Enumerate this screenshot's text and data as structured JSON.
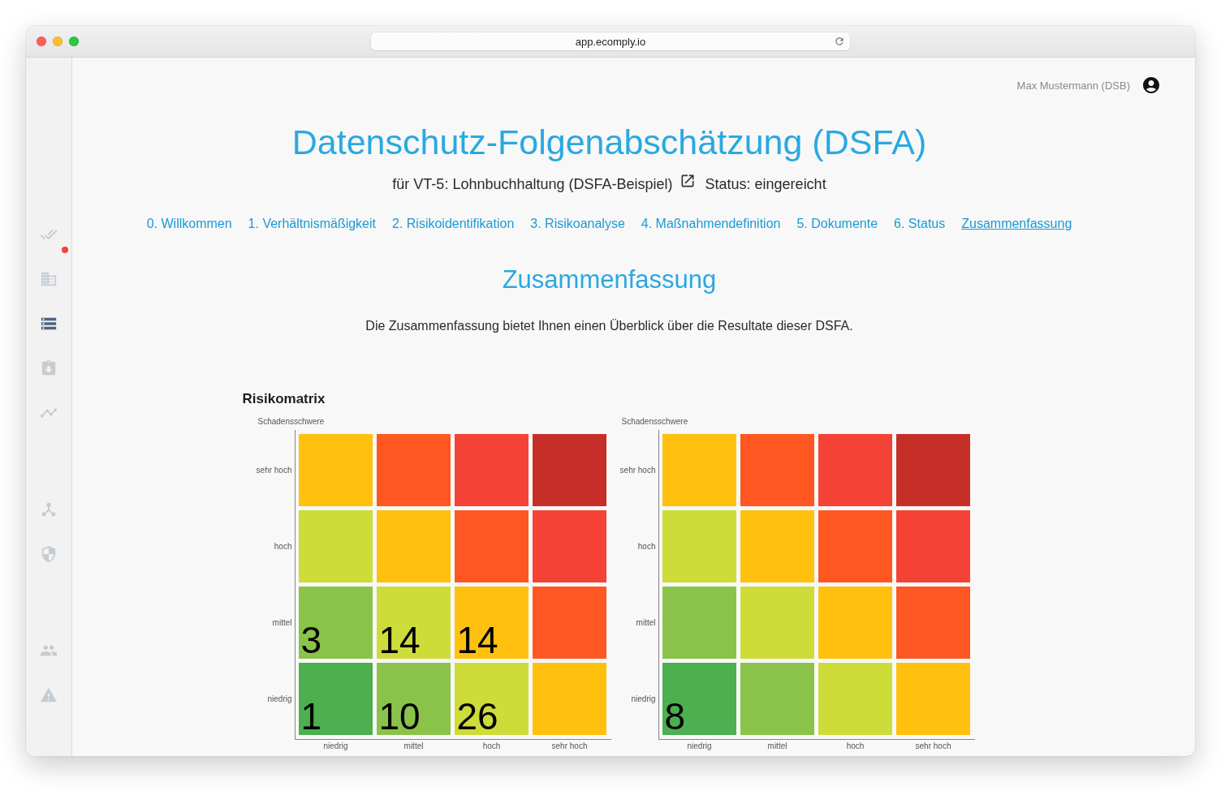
{
  "window": {
    "url": "app.ecomply.io"
  },
  "sidebar": {
    "groups": [
      {
        "items": [
          {
            "selected": false,
            "notification": true
          },
          {
            "selected": false,
            "notification": false
          },
          {
            "selected": true,
            "notification": false
          },
          {
            "selected": false,
            "notification": false
          },
          {
            "selected": false,
            "notification": false
          }
        ]
      },
      {
        "items": [
          {
            "selected": false,
            "notification": false
          },
          {
            "selected": false,
            "notification": false
          }
        ]
      },
      {
        "items": [
          {
            "selected": false,
            "notification": false
          },
          {
            "selected": false,
            "notification": false
          }
        ]
      }
    ]
  },
  "header": {
    "user": "Max Mustermann (DSB)"
  },
  "page": {
    "title": "Datenschutz-Folgenabschätzung (DSFA)",
    "subtitle": "für VT-5: Lohnbuchhaltung (DSFA-Beispiel)",
    "status": "Status: eingereicht"
  },
  "steps": [
    {
      "label": "0. Willkommen",
      "selected": false
    },
    {
      "label": "1. Verhältnismäßigkeit",
      "selected": false
    },
    {
      "label": "2. Risikoidentifikation",
      "selected": false
    },
    {
      "label": "3. Risikoanalyse",
      "selected": false
    },
    {
      "label": "4. Maßnahmendefinition",
      "selected": false
    },
    {
      "label": "5. Dokumente",
      "selected": false
    },
    {
      "label": "6. Status",
      "selected": false
    },
    {
      "label": "Zusammenfassung",
      "selected": true
    }
  ],
  "section": {
    "title": "Zusammenfassung",
    "intro": "Die Zusammenfassung bietet Ihnen einen Überblick über die Resultate dieser DSFA."
  },
  "risk_matrix": {
    "title": "Risikomatrix",
    "matrices": [
      {
        "ylabel": "Schadensschwere",
        "row_labels": [
          "sehr hoch",
          "hoch",
          "mittel",
          "niedrig"
        ],
        "column_labels": [
          "niedrig",
          "mittel",
          "hoch",
          "sehr hoch"
        ],
        "rows": [
          [
            {
              "color": "#ffc10e"
            },
            {
              "color": "#ff5722"
            },
            {
              "color": "#f44336"
            },
            {
              "color": "#c62f28"
            }
          ],
          [
            {
              "color": "#cddc39"
            },
            {
              "color": "#ffc10e"
            },
            {
              "color": "#ff5722"
            },
            {
              "color": "#f44336"
            }
          ],
          [
            {
              "color": "#8bc34a",
              "count": "3"
            },
            {
              "color": "#cddc39",
              "count": "14"
            },
            {
              "color": "#ffc10e",
              "count": "14"
            },
            {
              "color": "#ff5722"
            }
          ],
          [
            {
              "color": "#4caf50",
              "count": "1"
            },
            {
              "color": "#8bc34a",
              "count": "10"
            },
            {
              "color": "#cddc39",
              "count": "26"
            },
            {
              "color": "#ffc10e"
            }
          ]
        ]
      },
      {
        "ylabel": "Schadensschwere",
        "row_labels": [
          "sehr hoch",
          "hoch",
          "mittel",
          "niedrig"
        ],
        "column_labels": [
          "niedrig",
          "mittel",
          "hoch",
          "sehr hoch"
        ],
        "rows": [
          [
            {
              "color": "#ffc10e"
            },
            {
              "color": "#ff5722"
            },
            {
              "color": "#f44336"
            },
            {
              "color": "#c62f28"
            }
          ],
          [
            {
              "color": "#cddc39"
            },
            {
              "color": "#ffc10e"
            },
            {
              "color": "#ff5722"
            },
            {
              "color": "#f44336"
            }
          ],
          [
            {
              "color": "#8bc34a"
            },
            {
              "color": "#cddc39"
            },
            {
              "color": "#ffc10e"
            },
            {
              "color": "#ff5722"
            }
          ],
          [
            {
              "color": "#4caf50",
              "count": "8"
            },
            {
              "color": "#8bc34a"
            },
            {
              "color": "#cddc39"
            },
            {
              "color": "#ffc10e"
            }
          ]
        ]
      }
    ]
  }
}
